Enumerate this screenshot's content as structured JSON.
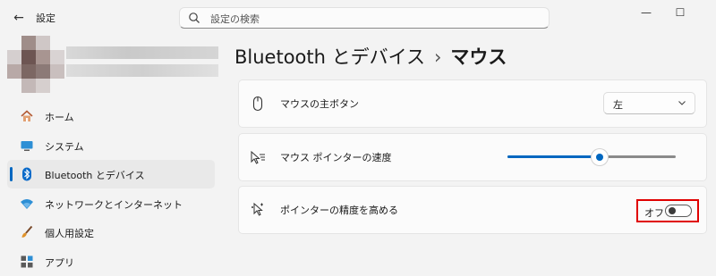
{
  "window": {
    "title": "設定",
    "back_icon": "arrow-left-icon",
    "controls": [
      "minimize-icon",
      "maximize-icon"
    ]
  },
  "search": {
    "placeholder": "設定の検索",
    "icon": "search-icon"
  },
  "sidebar": {
    "items": [
      {
        "label": "ホーム",
        "icon": "home-icon",
        "active": false
      },
      {
        "label": "システム",
        "icon": "monitor-icon",
        "active": false
      },
      {
        "label": "Bluetooth とデバイス",
        "icon": "bluetooth-icon",
        "active": true
      },
      {
        "label": "ネットワークとインターネット",
        "icon": "wifi-icon",
        "active": false
      },
      {
        "label": "個人用設定",
        "icon": "brush-icon",
        "active": false
      },
      {
        "label": "アプリ",
        "icon": "apps-icon",
        "active": false
      }
    ]
  },
  "breadcrumb": {
    "parent": "Bluetooth とデバイス",
    "separator": "›",
    "current": "マウス"
  },
  "settings": {
    "primary_button": {
      "label": "マウスの主ボタン",
      "icon": "mouse-icon",
      "value": "左"
    },
    "pointer_speed": {
      "label": "マウス ポインターの速度",
      "icon": "pointer-speed-icon",
      "value": 0.55
    },
    "pointer_precision": {
      "label": "ポインターの精度を高める",
      "icon": "pointer-precision-icon",
      "state_label": "オフ",
      "enabled": false
    }
  },
  "colors": {
    "accent": "#0067c0",
    "highlight_box": "#e00000",
    "background": "#f3f3f3"
  }
}
